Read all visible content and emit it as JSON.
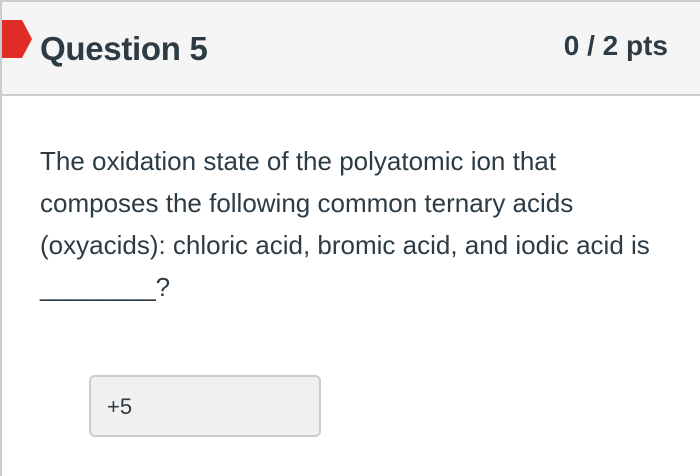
{
  "question": {
    "title": "Question 5",
    "points": "0 / 2 pts",
    "text": "The oxidation state of the polyatomic ion that composes the following common ternary acids (oxyacids): chloric acid, bromic acid, and iodic acid is ________?",
    "answer": "+5"
  },
  "colors": {
    "flag": "#e02b27",
    "header_bg": "#f5f5f5",
    "border": "#c7cdd1",
    "text": "#2d3b45",
    "answer_bg": "#f0f0f0"
  },
  "icons": {
    "flag": "bookmark-flag-icon"
  }
}
